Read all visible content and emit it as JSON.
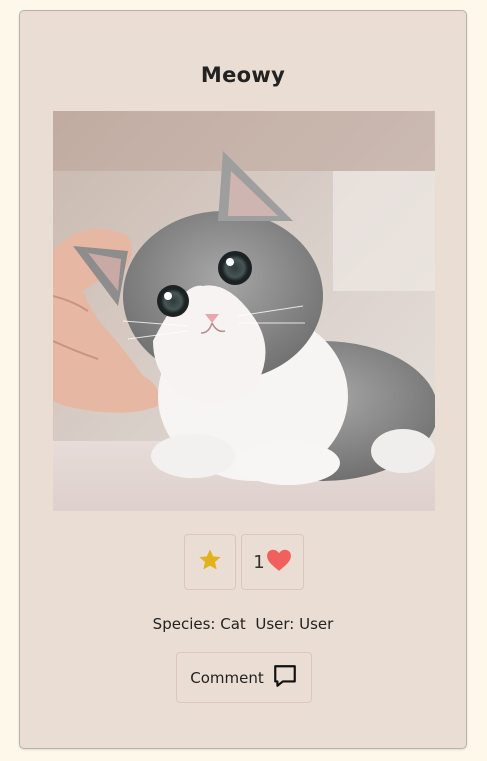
{
  "post": {
    "title": "Meowy",
    "image_alt": "kitten photo",
    "like_count": "1",
    "species_label": "Species:",
    "species_value": "Cat",
    "user_label": "User:",
    "user_value": "User",
    "comment_label": "Comment"
  },
  "icons": {
    "favorite": "star-icon",
    "like": "heart-icon",
    "comment": "speech-bubble-icon"
  },
  "colors": {
    "card_bg": "#eaddd3",
    "page_bg": "#fdf8ea",
    "star": "#e0b31c",
    "heart": "#f0605c"
  }
}
